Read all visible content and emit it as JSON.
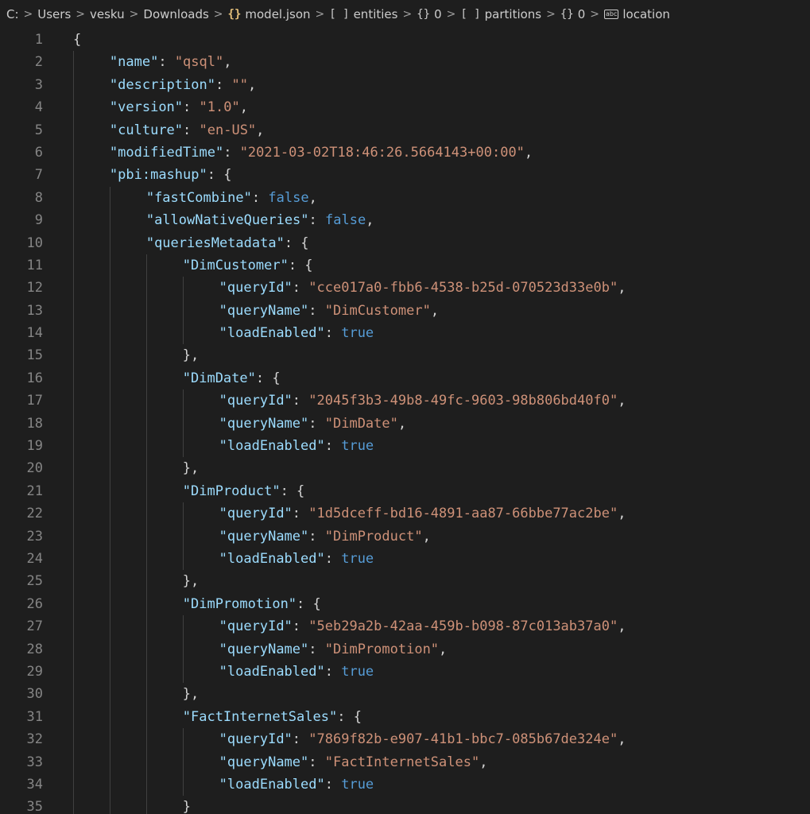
{
  "breadcrumb": {
    "items": [
      {
        "label": "C:",
        "icon": ""
      },
      {
        "label": "Users",
        "icon": ""
      },
      {
        "label": "vesku",
        "icon": ""
      },
      {
        "label": "Downloads",
        "icon": ""
      },
      {
        "label": "model.json",
        "icon": "json-file-icon"
      },
      {
        "label": "entities",
        "icon": "array-icon"
      },
      {
        "label": "0",
        "icon": "object-icon"
      },
      {
        "label": "partitions",
        "icon": "array-icon"
      },
      {
        "label": "0",
        "icon": "object-icon"
      },
      {
        "label": "location",
        "icon": "string-icon"
      }
    ]
  },
  "editor": {
    "lines": [
      {
        "n": "1",
        "indent": 0,
        "tokens": [
          [
            "punc",
            "{"
          ]
        ]
      },
      {
        "n": "2",
        "indent": 1,
        "tokens": [
          [
            "key",
            "\"name\""
          ],
          [
            "punc",
            ": "
          ],
          [
            "str",
            "\"qsql\""
          ],
          [
            "punc",
            ","
          ]
        ]
      },
      {
        "n": "3",
        "indent": 1,
        "tokens": [
          [
            "key",
            "\"description\""
          ],
          [
            "punc",
            ": "
          ],
          [
            "str",
            "\"\""
          ],
          [
            "punc",
            ","
          ]
        ]
      },
      {
        "n": "4",
        "indent": 1,
        "tokens": [
          [
            "key",
            "\"version\""
          ],
          [
            "punc",
            ": "
          ],
          [
            "str",
            "\"1.0\""
          ],
          [
            "punc",
            ","
          ]
        ]
      },
      {
        "n": "5",
        "indent": 1,
        "tokens": [
          [
            "key",
            "\"culture\""
          ],
          [
            "punc",
            ": "
          ],
          [
            "str",
            "\"en-US\""
          ],
          [
            "punc",
            ","
          ]
        ]
      },
      {
        "n": "6",
        "indent": 1,
        "tokens": [
          [
            "key",
            "\"modifiedTime\""
          ],
          [
            "punc",
            ": "
          ],
          [
            "str",
            "\"2021-03-02T18:46:26.5664143+00:00\""
          ],
          [
            "punc",
            ","
          ]
        ]
      },
      {
        "n": "7",
        "indent": 1,
        "tokens": [
          [
            "key",
            "\"pbi:mashup\""
          ],
          [
            "punc",
            ": {"
          ]
        ]
      },
      {
        "n": "8",
        "indent": 2,
        "tokens": [
          [
            "key",
            "\"fastCombine\""
          ],
          [
            "punc",
            ": "
          ],
          [
            "bool",
            "false"
          ],
          [
            "punc",
            ","
          ]
        ]
      },
      {
        "n": "9",
        "indent": 2,
        "tokens": [
          [
            "key",
            "\"allowNativeQueries\""
          ],
          [
            "punc",
            ": "
          ],
          [
            "bool",
            "false"
          ],
          [
            "punc",
            ","
          ]
        ]
      },
      {
        "n": "10",
        "indent": 2,
        "tokens": [
          [
            "key",
            "\"queriesMetadata\""
          ],
          [
            "punc",
            ": {"
          ]
        ]
      },
      {
        "n": "11",
        "indent": 3,
        "tokens": [
          [
            "key",
            "\"DimCustomer\""
          ],
          [
            "punc",
            ": {"
          ]
        ]
      },
      {
        "n": "12",
        "indent": 4,
        "tokens": [
          [
            "key",
            "\"queryId\""
          ],
          [
            "punc",
            ": "
          ],
          [
            "str",
            "\"cce017a0-fbb6-4538-b25d-070523d33e0b\""
          ],
          [
            "punc",
            ","
          ]
        ]
      },
      {
        "n": "13",
        "indent": 4,
        "tokens": [
          [
            "key",
            "\"queryName\""
          ],
          [
            "punc",
            ": "
          ],
          [
            "str",
            "\"DimCustomer\""
          ],
          [
            "punc",
            ","
          ]
        ]
      },
      {
        "n": "14",
        "indent": 4,
        "tokens": [
          [
            "key",
            "\"loadEnabled\""
          ],
          [
            "punc",
            ": "
          ],
          [
            "bool",
            "true"
          ]
        ]
      },
      {
        "n": "15",
        "indent": 3,
        "tokens": [
          [
            "punc",
            "},"
          ]
        ]
      },
      {
        "n": "16",
        "indent": 3,
        "tokens": [
          [
            "key",
            "\"DimDate\""
          ],
          [
            "punc",
            ": {"
          ]
        ]
      },
      {
        "n": "17",
        "indent": 4,
        "tokens": [
          [
            "key",
            "\"queryId\""
          ],
          [
            "punc",
            ": "
          ],
          [
            "str",
            "\"2045f3b3-49b8-49fc-9603-98b806bd40f0\""
          ],
          [
            "punc",
            ","
          ]
        ]
      },
      {
        "n": "18",
        "indent": 4,
        "tokens": [
          [
            "key",
            "\"queryName\""
          ],
          [
            "punc",
            ": "
          ],
          [
            "str",
            "\"DimDate\""
          ],
          [
            "punc",
            ","
          ]
        ]
      },
      {
        "n": "19",
        "indent": 4,
        "tokens": [
          [
            "key",
            "\"loadEnabled\""
          ],
          [
            "punc",
            ": "
          ],
          [
            "bool",
            "true"
          ]
        ]
      },
      {
        "n": "20",
        "indent": 3,
        "tokens": [
          [
            "punc",
            "},"
          ]
        ]
      },
      {
        "n": "21",
        "indent": 3,
        "tokens": [
          [
            "key",
            "\"DimProduct\""
          ],
          [
            "punc",
            ": {"
          ]
        ]
      },
      {
        "n": "22",
        "indent": 4,
        "tokens": [
          [
            "key",
            "\"queryId\""
          ],
          [
            "punc",
            ": "
          ],
          [
            "str",
            "\"1d5dceff-bd16-4891-aa87-66bbe77ac2be\""
          ],
          [
            "punc",
            ","
          ]
        ]
      },
      {
        "n": "23",
        "indent": 4,
        "tokens": [
          [
            "key",
            "\"queryName\""
          ],
          [
            "punc",
            ": "
          ],
          [
            "str",
            "\"DimProduct\""
          ],
          [
            "punc",
            ","
          ]
        ]
      },
      {
        "n": "24",
        "indent": 4,
        "tokens": [
          [
            "key",
            "\"loadEnabled\""
          ],
          [
            "punc",
            ": "
          ],
          [
            "bool",
            "true"
          ]
        ]
      },
      {
        "n": "25",
        "indent": 3,
        "tokens": [
          [
            "punc",
            "},"
          ]
        ]
      },
      {
        "n": "26",
        "indent": 3,
        "tokens": [
          [
            "key",
            "\"DimPromotion\""
          ],
          [
            "punc",
            ": {"
          ]
        ]
      },
      {
        "n": "27",
        "indent": 4,
        "tokens": [
          [
            "key",
            "\"queryId\""
          ],
          [
            "punc",
            ": "
          ],
          [
            "str",
            "\"5eb29a2b-42aa-459b-b098-87c013ab37a0\""
          ],
          [
            "punc",
            ","
          ]
        ]
      },
      {
        "n": "28",
        "indent": 4,
        "tokens": [
          [
            "key",
            "\"queryName\""
          ],
          [
            "punc",
            ": "
          ],
          [
            "str",
            "\"DimPromotion\""
          ],
          [
            "punc",
            ","
          ]
        ]
      },
      {
        "n": "29",
        "indent": 4,
        "tokens": [
          [
            "key",
            "\"loadEnabled\""
          ],
          [
            "punc",
            ": "
          ],
          [
            "bool",
            "true"
          ]
        ]
      },
      {
        "n": "30",
        "indent": 3,
        "tokens": [
          [
            "punc",
            "},"
          ]
        ]
      },
      {
        "n": "31",
        "indent": 3,
        "tokens": [
          [
            "key",
            "\"FactInternetSales\""
          ],
          [
            "punc",
            ": {"
          ]
        ]
      },
      {
        "n": "32",
        "indent": 4,
        "tokens": [
          [
            "key",
            "\"queryId\""
          ],
          [
            "punc",
            ": "
          ],
          [
            "str",
            "\"7869f82b-e907-41b1-bbc7-085b67de324e\""
          ],
          [
            "punc",
            ","
          ]
        ]
      },
      {
        "n": "33",
        "indent": 4,
        "tokens": [
          [
            "key",
            "\"queryName\""
          ],
          [
            "punc",
            ": "
          ],
          [
            "str",
            "\"FactInternetSales\""
          ],
          [
            "punc",
            ","
          ]
        ]
      },
      {
        "n": "34",
        "indent": 4,
        "tokens": [
          [
            "key",
            "\"loadEnabled\""
          ],
          [
            "punc",
            ": "
          ],
          [
            "bool",
            "true"
          ]
        ]
      },
      {
        "n": "35",
        "indent": 3,
        "tokens": [
          [
            "punc",
            "}"
          ]
        ]
      }
    ]
  },
  "colors": {
    "background": "#1e1e1e",
    "key": "#9cdcfe",
    "string": "#ce9178",
    "boolean": "#569cd6",
    "punctuation": "#d4d4d4",
    "line_number": "#858585"
  }
}
